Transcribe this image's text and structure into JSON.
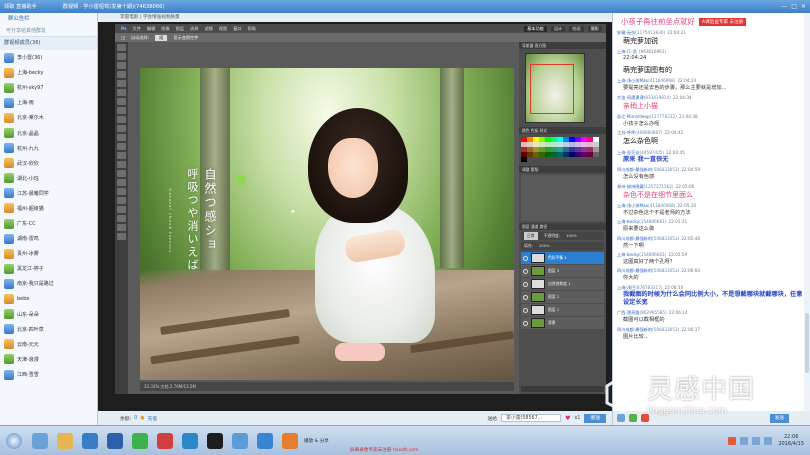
{
  "window": {
    "top_left_label": "领取 直播助手",
    "room_title": "群视频 · 学小雷桓驾(发第十期)(74638066)",
    "controls": [
      "—",
      "□",
      "×"
    ]
  },
  "sidebar": {
    "header": "群公告栏",
    "sub": "可分享给其他群友",
    "group_label": "群视频成员(36)",
    "members": [
      "李小雷(36)",
      "上海-becky",
      "杭州-sky97",
      "上海-雨",
      "北京-莱尔木",
      "北京-晶晶",
      "杭州-九九",
      "武汉-欣欣",
      "湖北-小珏",
      "江苏-晨曦同学",
      "福州-超级猫",
      "广东-CC",
      "湖南-雷鸣",
      "贵州-冰雾",
      "黑龙江-婷子",
      "南京-我只是路过",
      "bebe",
      "山东-朵朵",
      "北京-四叶草",
      "云南-元元",
      "天津-浪漫",
      "江西-雪雪"
    ]
  },
  "main": {
    "breadcrumb": "李雷电影 | 学会增强视频质量",
    "ps": {
      "menu": [
        "Ps",
        "文件",
        "编辑",
        "图像",
        "图层",
        "选择",
        "滤镜",
        "视图",
        "窗口",
        "帮助"
      ],
      "workspaces": [
        "基本功能",
        "设计",
        "绘画",
        "摄影"
      ],
      "workspace_active": "基本功能",
      "options": [
        "◫",
        "自动选择:",
        "组",
        "显示变换控件"
      ],
      "options_selected": "组",
      "canvas_text": {
        "line1": "自然つ感ショ",
        "line2": "呼吸つや消いえば",
        "small": "Natural cheek forests"
      },
      "status": "33.33% 文档:2.76M/13.5M",
      "panels": {
        "navigator_tab": "导航器 直方图",
        "swatch_tab": "颜色 色板 样式",
        "adjust_tab": "调整 蒙版",
        "layers_tab": "图层 通道 路径",
        "blend_mode": "正常",
        "opacity_label": "不透明度:",
        "opacity": "100%",
        "fill_label": "填充:",
        "fill": "100%"
      },
      "layers": [
        {
          "name": "色彩平衡 1",
          "active": true
        },
        {
          "name": "图层 3",
          "active": false
        },
        {
          "name": "自然饱和度 1",
          "active": false
        },
        {
          "name": "图层 2",
          "active": false
        },
        {
          "name": "图层 1",
          "active": false
        },
        {
          "name": "背景",
          "active": false
        }
      ],
      "swatch_colors": [
        "#ff0000",
        "#ff7f00",
        "#ffff00",
        "#7fff00",
        "#00ff00",
        "#00ff7f",
        "#00ffff",
        "#007fff",
        "#0000ff",
        "#7f00ff",
        "#ff00ff",
        "#ff007f",
        "#ffffff",
        "#e6b8b8",
        "#e6cfb8",
        "#e6e6b8",
        "#cfe6b8",
        "#b8e6b8",
        "#b8e6cf",
        "#b8e6e6",
        "#b8cfe6",
        "#b8b8e6",
        "#cfb8e6",
        "#e6b8e6",
        "#e6b8cf",
        "#cccccc",
        "#993333",
        "#996633",
        "#999933",
        "#669933",
        "#339933",
        "#339966",
        "#339999",
        "#336699",
        "#333399",
        "#663399",
        "#993399",
        "#993366",
        "#999999",
        "#660000",
        "#663300",
        "#666600",
        "#336600",
        "#006600",
        "#006633",
        "#006666",
        "#003366",
        "#000066",
        "#330066",
        "#660066",
        "#660033",
        "#666666",
        "#000000"
      ]
    },
    "bottom": {
      "balance_label": "余额:",
      "balance": "0",
      "charge": "充值",
      "gift_to_label": "送给",
      "gift_to": "李小雷(58567...",
      "gift_count": "x1",
      "send_gift": "赠送"
    }
  },
  "chat": {
    "banner_text": "小孩子再往前坐点就好",
    "banner_badge": "A课后盗专家 未注册",
    "messages": [
      {
        "who": "安徽-无伤",
        "id": "(1175411830)",
        "time": "22:04:21",
        "text": "萌完萝加锐",
        "style": "big"
      },
      {
        "who": "上海-",
        "id": "[1-惠",
        "time": "(963616961)",
        "text": "22:04:24",
        "style": "small"
      },
      {
        "who": "",
        "id": "",
        "time": "",
        "text": "萌完萝国图有的",
        "style": "big"
      },
      {
        "who": "上海-浅小孩Max",
        "id": "(411846968)",
        "time": "22:04:24",
        "text": "要提亮还是去色的步骤，那么主要就是增加...",
        "style": "small"
      },
      {
        "who": "大连-同理课课",
        "id": "(833419814)",
        "time": "22:04:34",
        "text": "亲稍上小猫",
        "style": "pink"
      },
      {
        "who": "浙江-Mirrordeep",
        "id": "(127776232)",
        "time": "22:04:38",
        "text": "小孩子怎么办呢",
        "style": "small"
      },
      {
        "who": "江苏-呼呼",
        "id": "(408080867)",
        "time": "22:04:42",
        "text": "怎么杂色啊",
        "style": "big"
      },
      {
        "who": "上海-亚茫丝",
        "id": "(44597405)",
        "time": "22:04:45",
        "text": "原来 我一直很无",
        "style": "blue"
      },
      {
        "who": "四川成都-最强新的",
        "id": "(506833053)",
        "time": "22:04:59",
        "text": "怎么没有色感",
        "style": "small"
      },
      {
        "who": "郑州-修持隐藏",
        "id": "(1257371562)",
        "time": "22:05:06",
        "text": "杂色不是在细节里面么",
        "style": "pink"
      },
      {
        "who": "上海-浅小孩Max",
        "id": "(411846968)",
        "time": "22:05:20",
        "text": "不过杂色这个不是老师的方法",
        "style": "small"
      },
      {
        "who": "上海-becky",
        "id": "(154806661)",
        "time": "22:05:31",
        "text": "原来要这么做",
        "style": "small"
      },
      {
        "who": "四川成都-最强新的",
        "id": "(506833053)",
        "time": "22:05:48",
        "text": "然一下啊",
        "style": "small"
      },
      {
        "who": "上海-becky",
        "id": "(154806661)",
        "time": "22:05:59",
        "text": "这图真好了两个孔呀？",
        "style": "small"
      },
      {
        "who": "四川成都-最强新的",
        "id": "(506833053)",
        "time": "22:06:04",
        "text": "你大的",
        "style": "small"
      },
      {
        "who": "上海-浅巴",
        "id": "(876783317)",
        "time": "22:06:10",
        "text": "我截图的时候为什么会同比例大小，不是想截哪块就截哪块，任意设定长宽",
        "style": "blue"
      },
      {
        "who": "广西-漂亮路",
        "id": "(862965585)",
        "time": "22:06:14",
        "text": "截图可以截相框的",
        "style": "small"
      },
      {
        "who": "四川成都-最强新的",
        "id": "(506833053)",
        "time": "22:06:17",
        "text": "图片比较...",
        "style": "small"
      }
    ],
    "input_send": "发送"
  },
  "watermark": {
    "cn": "灵感中国",
    "en": "lingganchina.com"
  },
  "taskbar": {
    "label": "播放 & 分享",
    "promo": "屏幕录像专家未注册 tlxsoft.com",
    "time": "22:06",
    "date": "2016/4/15"
  }
}
